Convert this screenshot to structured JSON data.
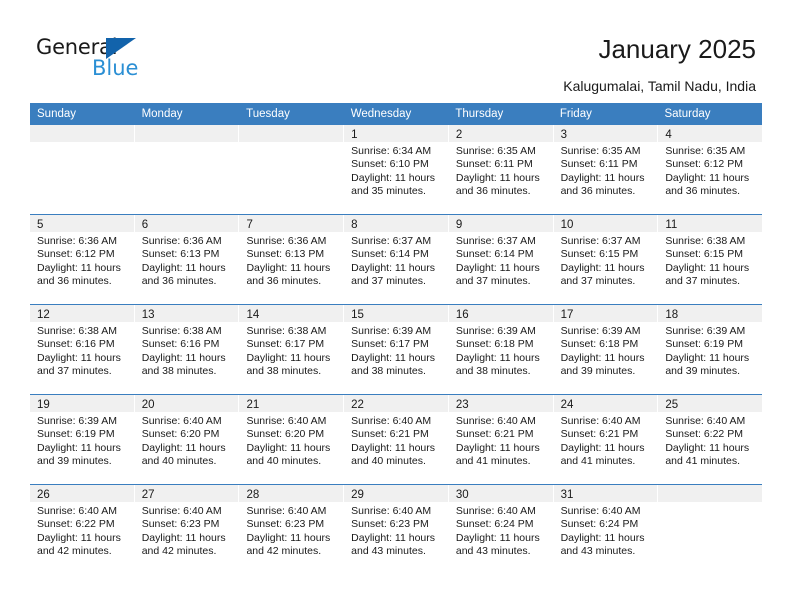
{
  "brand": {
    "name_top": "General",
    "name_bottom": "Blue",
    "triangle_color": "#1263ab",
    "blue_text_color": "#2b8fd4"
  },
  "header": {
    "title": "January 2025",
    "subtitle": "Kalugumalai, Tamil Nadu, India"
  },
  "theme": {
    "header_bar_color": "#3a7ebf",
    "daynum_band_color": "#f0f0f0",
    "text_color": "#1a1a1a"
  },
  "calendar": {
    "weekday_headers": [
      "Sunday",
      "Monday",
      "Tuesday",
      "Wednesday",
      "Thursday",
      "Friday",
      "Saturday"
    ],
    "weeks": [
      [
        {
          "day": "",
          "sunrise": "",
          "sunset": "",
          "daylight_a": "",
          "daylight_b": ""
        },
        {
          "day": "",
          "sunrise": "",
          "sunset": "",
          "daylight_a": "",
          "daylight_b": ""
        },
        {
          "day": "",
          "sunrise": "",
          "sunset": "",
          "daylight_a": "",
          "daylight_b": ""
        },
        {
          "day": "1",
          "sunrise": "Sunrise: 6:34 AM",
          "sunset": "Sunset: 6:10 PM",
          "daylight_a": "Daylight: 11 hours",
          "daylight_b": "and 35 minutes."
        },
        {
          "day": "2",
          "sunrise": "Sunrise: 6:35 AM",
          "sunset": "Sunset: 6:11 PM",
          "daylight_a": "Daylight: 11 hours",
          "daylight_b": "and 36 minutes."
        },
        {
          "day": "3",
          "sunrise": "Sunrise: 6:35 AM",
          "sunset": "Sunset: 6:11 PM",
          "daylight_a": "Daylight: 11 hours",
          "daylight_b": "and 36 minutes."
        },
        {
          "day": "4",
          "sunrise": "Sunrise: 6:35 AM",
          "sunset": "Sunset: 6:12 PM",
          "daylight_a": "Daylight: 11 hours",
          "daylight_b": "and 36 minutes."
        }
      ],
      [
        {
          "day": "5",
          "sunrise": "Sunrise: 6:36 AM",
          "sunset": "Sunset: 6:12 PM",
          "daylight_a": "Daylight: 11 hours",
          "daylight_b": "and 36 minutes."
        },
        {
          "day": "6",
          "sunrise": "Sunrise: 6:36 AM",
          "sunset": "Sunset: 6:13 PM",
          "daylight_a": "Daylight: 11 hours",
          "daylight_b": "and 36 minutes."
        },
        {
          "day": "7",
          "sunrise": "Sunrise: 6:36 AM",
          "sunset": "Sunset: 6:13 PM",
          "daylight_a": "Daylight: 11 hours",
          "daylight_b": "and 36 minutes."
        },
        {
          "day": "8",
          "sunrise": "Sunrise: 6:37 AM",
          "sunset": "Sunset: 6:14 PM",
          "daylight_a": "Daylight: 11 hours",
          "daylight_b": "and 37 minutes."
        },
        {
          "day": "9",
          "sunrise": "Sunrise: 6:37 AM",
          "sunset": "Sunset: 6:14 PM",
          "daylight_a": "Daylight: 11 hours",
          "daylight_b": "and 37 minutes."
        },
        {
          "day": "10",
          "sunrise": "Sunrise: 6:37 AM",
          "sunset": "Sunset: 6:15 PM",
          "daylight_a": "Daylight: 11 hours",
          "daylight_b": "and 37 minutes."
        },
        {
          "day": "11",
          "sunrise": "Sunrise: 6:38 AM",
          "sunset": "Sunset: 6:15 PM",
          "daylight_a": "Daylight: 11 hours",
          "daylight_b": "and 37 minutes."
        }
      ],
      [
        {
          "day": "12",
          "sunrise": "Sunrise: 6:38 AM",
          "sunset": "Sunset: 6:16 PM",
          "daylight_a": "Daylight: 11 hours",
          "daylight_b": "and 37 minutes."
        },
        {
          "day": "13",
          "sunrise": "Sunrise: 6:38 AM",
          "sunset": "Sunset: 6:16 PM",
          "daylight_a": "Daylight: 11 hours",
          "daylight_b": "and 38 minutes."
        },
        {
          "day": "14",
          "sunrise": "Sunrise: 6:38 AM",
          "sunset": "Sunset: 6:17 PM",
          "daylight_a": "Daylight: 11 hours",
          "daylight_b": "and 38 minutes."
        },
        {
          "day": "15",
          "sunrise": "Sunrise: 6:39 AM",
          "sunset": "Sunset: 6:17 PM",
          "daylight_a": "Daylight: 11 hours",
          "daylight_b": "and 38 minutes."
        },
        {
          "day": "16",
          "sunrise": "Sunrise: 6:39 AM",
          "sunset": "Sunset: 6:18 PM",
          "daylight_a": "Daylight: 11 hours",
          "daylight_b": "and 38 minutes."
        },
        {
          "day": "17",
          "sunrise": "Sunrise: 6:39 AM",
          "sunset": "Sunset: 6:18 PM",
          "daylight_a": "Daylight: 11 hours",
          "daylight_b": "and 39 minutes."
        },
        {
          "day": "18",
          "sunrise": "Sunrise: 6:39 AM",
          "sunset": "Sunset: 6:19 PM",
          "daylight_a": "Daylight: 11 hours",
          "daylight_b": "and 39 minutes."
        }
      ],
      [
        {
          "day": "19",
          "sunrise": "Sunrise: 6:39 AM",
          "sunset": "Sunset: 6:19 PM",
          "daylight_a": "Daylight: 11 hours",
          "daylight_b": "and 39 minutes."
        },
        {
          "day": "20",
          "sunrise": "Sunrise: 6:40 AM",
          "sunset": "Sunset: 6:20 PM",
          "daylight_a": "Daylight: 11 hours",
          "daylight_b": "and 40 minutes."
        },
        {
          "day": "21",
          "sunrise": "Sunrise: 6:40 AM",
          "sunset": "Sunset: 6:20 PM",
          "daylight_a": "Daylight: 11 hours",
          "daylight_b": "and 40 minutes."
        },
        {
          "day": "22",
          "sunrise": "Sunrise: 6:40 AM",
          "sunset": "Sunset: 6:21 PM",
          "daylight_a": "Daylight: 11 hours",
          "daylight_b": "and 40 minutes."
        },
        {
          "day": "23",
          "sunrise": "Sunrise: 6:40 AM",
          "sunset": "Sunset: 6:21 PM",
          "daylight_a": "Daylight: 11 hours",
          "daylight_b": "and 41 minutes."
        },
        {
          "day": "24",
          "sunrise": "Sunrise: 6:40 AM",
          "sunset": "Sunset: 6:21 PM",
          "daylight_a": "Daylight: 11 hours",
          "daylight_b": "and 41 minutes."
        },
        {
          "day": "25",
          "sunrise": "Sunrise: 6:40 AM",
          "sunset": "Sunset: 6:22 PM",
          "daylight_a": "Daylight: 11 hours",
          "daylight_b": "and 41 minutes."
        }
      ],
      [
        {
          "day": "26",
          "sunrise": "Sunrise: 6:40 AM",
          "sunset": "Sunset: 6:22 PM",
          "daylight_a": "Daylight: 11 hours",
          "daylight_b": "and 42 minutes."
        },
        {
          "day": "27",
          "sunrise": "Sunrise: 6:40 AM",
          "sunset": "Sunset: 6:23 PM",
          "daylight_a": "Daylight: 11 hours",
          "daylight_b": "and 42 minutes."
        },
        {
          "day": "28",
          "sunrise": "Sunrise: 6:40 AM",
          "sunset": "Sunset: 6:23 PM",
          "daylight_a": "Daylight: 11 hours",
          "daylight_b": "and 42 minutes."
        },
        {
          "day": "29",
          "sunrise": "Sunrise: 6:40 AM",
          "sunset": "Sunset: 6:23 PM",
          "daylight_a": "Daylight: 11 hours",
          "daylight_b": "and 43 minutes."
        },
        {
          "day": "30",
          "sunrise": "Sunrise: 6:40 AM",
          "sunset": "Sunset: 6:24 PM",
          "daylight_a": "Daylight: 11 hours",
          "daylight_b": "and 43 minutes."
        },
        {
          "day": "31",
          "sunrise": "Sunrise: 6:40 AM",
          "sunset": "Sunset: 6:24 PM",
          "daylight_a": "Daylight: 11 hours",
          "daylight_b": "and 43 minutes."
        },
        {
          "day": "",
          "sunrise": "",
          "sunset": "",
          "daylight_a": "",
          "daylight_b": ""
        }
      ]
    ]
  }
}
